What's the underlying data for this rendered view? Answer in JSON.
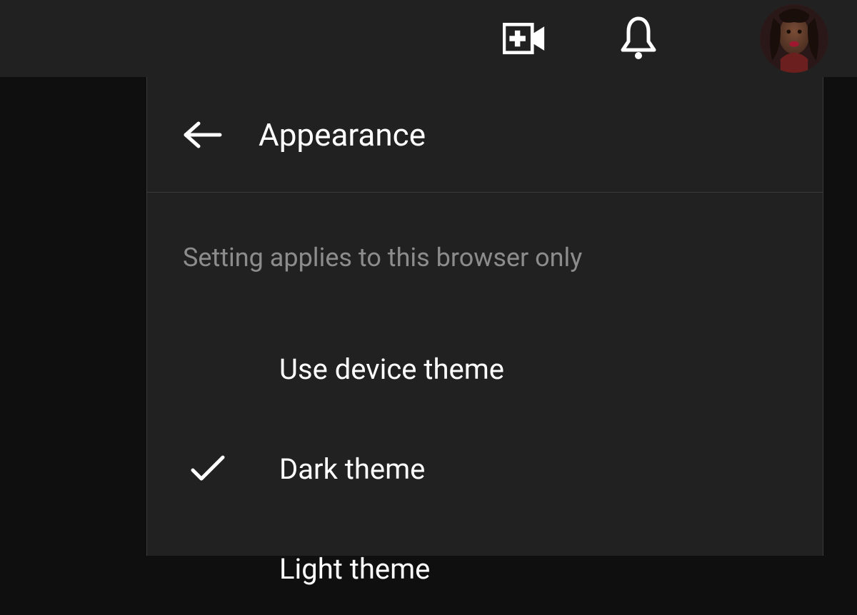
{
  "panel": {
    "title": "Appearance",
    "hint": "Setting applies to this browser only",
    "options": [
      {
        "label": "Use device theme",
        "selected": false
      },
      {
        "label": "Dark theme",
        "selected": true
      },
      {
        "label": "Light theme",
        "selected": false
      }
    ]
  }
}
